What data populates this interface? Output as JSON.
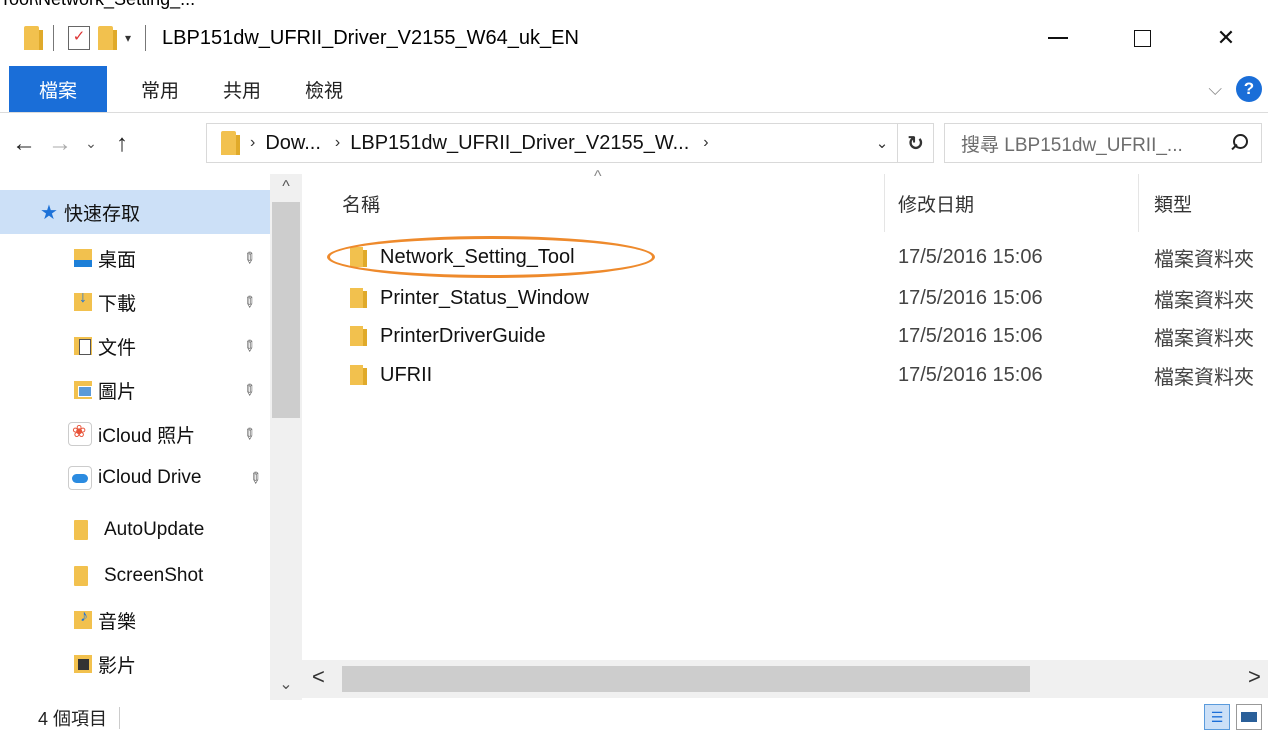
{
  "top_strip_text": "Tool\\Network_Setting_...",
  "window": {
    "title": "LBP151dw_UFRII_Driver_V2155_W64_uk_EN",
    "close_glyph": "✕"
  },
  "ribbon": {
    "tabs": [
      "檔案",
      "常用",
      "共用",
      "檢視"
    ],
    "expand_glyph": "⌵",
    "help_glyph": "?"
  },
  "address": {
    "back_glyph": "←",
    "forward_glyph": "→",
    "recent_glyph": "⌄",
    "up_glyph": "↑",
    "crumbs": [
      "Dow...",
      "LBP151dw_UFRII_Driver_V2155_W..."
    ],
    "crumb_sep": "›",
    "dropdown_glyph": "⌄",
    "refresh_glyph": "↻",
    "search_placeholder": "搜尋 LBP151dw_UFRII_..."
  },
  "nav": {
    "items": [
      {
        "label": "快速存取",
        "icon": "star-icon",
        "pinned": false
      },
      {
        "label": "桌面",
        "icon": "desktop-folder-icon",
        "pinned": true
      },
      {
        "label": "下載",
        "icon": "downloads-folder-icon",
        "pinned": true
      },
      {
        "label": "文件",
        "icon": "documents-folder-icon",
        "pinned": true
      },
      {
        "label": "圖片",
        "icon": "pictures-folder-icon",
        "pinned": true
      },
      {
        "label": "iCloud 照片",
        "icon": "icloud-photos-icon",
        "pinned": true
      },
      {
        "label": "iCloud Drive",
        "icon": "icloud-drive-icon",
        "pinned": true
      },
      {
        "label": "AutoUpdate",
        "icon": "folder-icon",
        "pinned": false
      },
      {
        "label": "ScreenShot",
        "icon": "folder-icon",
        "pinned": false
      },
      {
        "label": "音樂",
        "icon": "music-folder-icon",
        "pinned": false
      },
      {
        "label": "影片",
        "icon": "videos-folder-icon",
        "pinned": false
      }
    ],
    "pin_glyph": "📌",
    "scroll_up": "^",
    "scroll_down": "⌄"
  },
  "content": {
    "columns": {
      "name": "名稱",
      "modified": "修改日期",
      "type": "類型"
    },
    "sort_glyph": "^",
    "files": [
      {
        "name": "Network_Setting_Tool",
        "modified": "17/5/2016 15:06",
        "type": "檔案資料夾",
        "highlighted": true
      },
      {
        "name": "Printer_Status_Window",
        "modified": "17/5/2016 15:06",
        "type": "檔案資料夾",
        "highlighted": false
      },
      {
        "name": "PrinterDriverGuide",
        "modified": "17/5/2016 15:06",
        "type": "檔案資料夾",
        "highlighted": false
      },
      {
        "name": "UFRII",
        "modified": "17/5/2016 15:06",
        "type": "檔案資料夾",
        "highlighted": false
      }
    ],
    "hscroll_left": "<",
    "hscroll_right": ">"
  },
  "status": {
    "item_count": "4 個項目"
  },
  "colors": {
    "accent": "#1a6ed8",
    "selection": "#cce0f7",
    "folder": "#f2c14e",
    "highlight_ring": "#ee8a2c"
  }
}
